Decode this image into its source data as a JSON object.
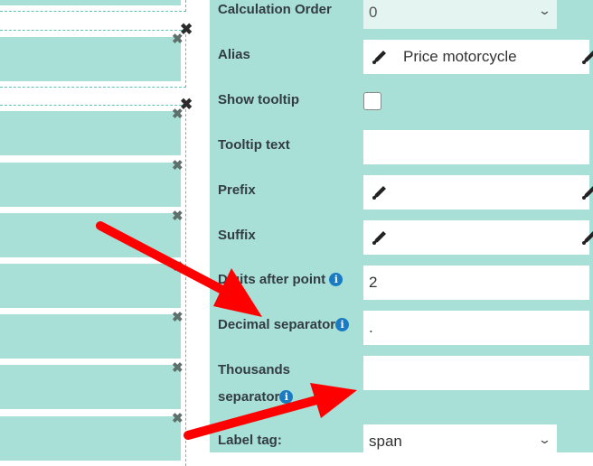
{
  "form": {
    "calculation_order": {
      "label": "Calculation Order",
      "value": "0"
    },
    "alias": {
      "label": "Alias",
      "value": "Price motorcycle"
    },
    "show_tooltip": {
      "label": "Show tooltip",
      "checked": false
    },
    "tooltip_text": {
      "label": "Tooltip text",
      "value": ""
    },
    "prefix": {
      "label": "Prefix",
      "value": ""
    },
    "suffix": {
      "label": "Suffix",
      "value": ""
    },
    "digits_after_point": {
      "label": "Digits after point",
      "value": "2"
    },
    "decimal_separator": {
      "label": "Decimal separator",
      "value": "."
    },
    "thousands_separator": {
      "label_line1": "Thousands",
      "label_line2": "separator",
      "value": ""
    },
    "label_tag": {
      "label": "Label tag:",
      "value": "span"
    }
  },
  "icons": {
    "close": "✖",
    "chevron": "⌄",
    "info": "i"
  },
  "colors": {
    "panel_bg": "#a8e0d7",
    "arrow": "#ff0000",
    "info": "#1a7bc2"
  }
}
